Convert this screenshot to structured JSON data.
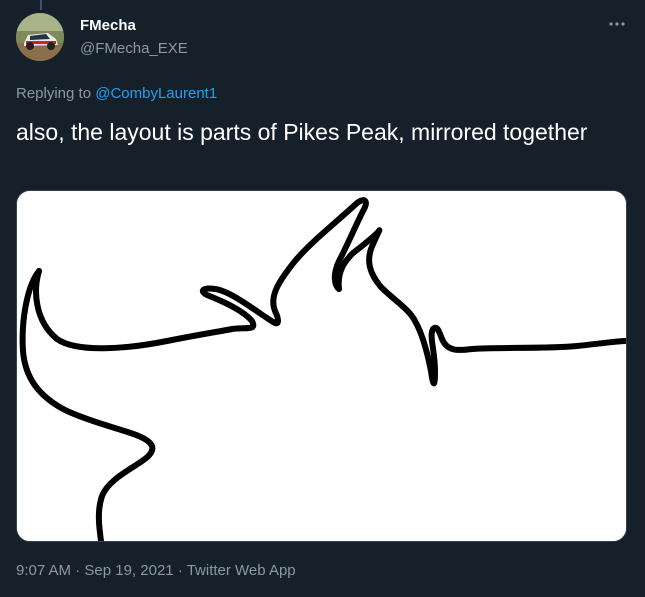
{
  "author": {
    "display_name": "FMecha",
    "handle": "@FMecha_EXE"
  },
  "reply": {
    "prefix": "Replying to ",
    "mention": "@CombyLaurent1"
  },
  "tweet_text": "also, the layout is parts of Pikes Peak, mirrored together",
  "meta": {
    "time": "9:07 AM",
    "date": "Sep 19, 2021",
    "source": "Twitter Web App",
    "separator": " · "
  },
  "colors": {
    "background": "#15202b",
    "secondary_text": "#8b98a5",
    "link": "#1d9bf0"
  },
  "icons": {
    "more": "more-options-icon",
    "avatar": "rally-car-avatar"
  }
}
